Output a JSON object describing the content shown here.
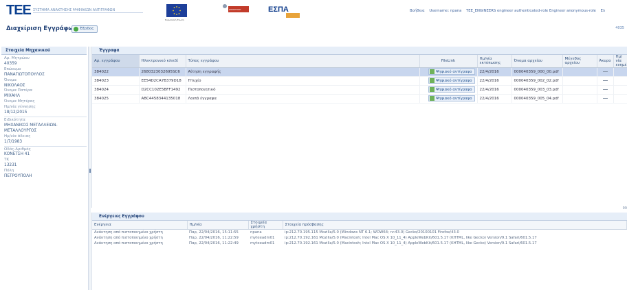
{
  "brand": {
    "logo": "ΤΕΕ",
    "subtitle": "ΣΥΣΤΗΜΑ ΑΝΑΚΤΗΣΗΣ ΨΗΦΙΑΚΩΝ ΑΝΤΙΓΡΑΦΩΝ",
    "eu_caption": "Ευρωπαϊκή Ένωση",
    "ministry": "ΔΙΟΙΚΗΤΙΚΗ ΜΕΤΑΡΡΥΘΜΙΣΗ",
    "espa": "ΕΣΠΑ",
    "espa_years": "2007-2013"
  },
  "header": {
    "help": "Βοήθεια",
    "username": "Username: npana",
    "roles": "TEE_ENGINEERS engineer authenticated-role Engineer anonymous-role",
    "lang": "Ελ",
    "right_extra": "4035"
  },
  "page": {
    "title": "Διαχείριση Εγγράφων",
    "exit_label": "Έξοδος"
  },
  "colors": {
    "accent": "#1d3e74",
    "header_bg": "#e6eef8",
    "selected_row": "#c8d6ee"
  },
  "sidebar": {
    "title": "Στοιχεία Μηχανικού",
    "fields": [
      {
        "label": "Αρ. Μητρώου",
        "value": "40359"
      },
      {
        "label": "Επώνυμο",
        "value": "ΠΑΝΑΓΙΩΤΟΠΟΥΛΟΣ"
      },
      {
        "label": "Όνομα",
        "value": "ΝΙΚΟΛΑΟΣ"
      },
      {
        "label": "Όνομα Πατέρα",
        "value": "ΜΙΧΑΗΛ"
      },
      {
        "label": "Όνομα Μητέρας",
        "value": ""
      },
      {
        "label": "Ημ/νία γέννησης",
        "value": "18/12/2015"
      }
    ],
    "fields2": [
      {
        "label": "Ειδικότητα",
        "value": "ΜΗΧΑΝΙΚΟΣ ΜΕΤΑΛΛΕΙΩΝ-ΜΕΤΑΛΛΟΥΡΓΟΣ"
      },
      {
        "label": "Ημ/νία άδειας",
        "value": "1/7/1983"
      }
    ],
    "fields3": [
      {
        "label": "Οδός-Αριθμός",
        "value": "ΚΟΝΕΤΣΗ 41"
      },
      {
        "label": "ΤΚ",
        "value": "13231"
      },
      {
        "label": "Πόλη",
        "value": "ΠΕΤΡΟΥΠΟΛΗ"
      }
    ]
  },
  "documents": {
    "title": "Έγγραφα",
    "columns": [
      "Αρ. εγγράφου",
      "Ηλεκτρονικό κλειδί",
      "Τύπος εγγράφου",
      "FileLink",
      "Ημ/νία εκτύπωσης",
      "Όνομα αρχείου",
      "Μέγεθος αρχείου",
      "Άκυρο",
      "Ημ/νία ενημέρωσης"
    ],
    "link_label": "Ψηφιακό αντίγραφο",
    "rows": [
      {
        "no": "384022",
        "key": "2680323032695SC6",
        "type": "Αίτηση εγγραφής",
        "date": "22/4/2016",
        "file": "000040359_000_00.pdf"
      },
      {
        "no": "384023",
        "key": "EE54D2CA7B379D18",
        "type": "Πτυχίο",
        "date": "22/4/2016",
        "file": "000040359_002_02.pdf"
      },
      {
        "no": "384024",
        "key": "D2CC102E5BFF1492",
        "type": "Πιστοποιητικό",
        "date": "22/4/2016",
        "file": "000040359_003_03.pdf"
      },
      {
        "no": "384025",
        "key": "ABC4458344135018",
        "type": "Λοιπά έγγραφα",
        "date": "22/4/2016",
        "file": "000040359_005_04.pdf"
      }
    ],
    "extra": "99"
  },
  "activity": {
    "title": "Ενέργειες Εγγράφου",
    "columns": [
      "Ενέργεια",
      "Ημ/νία",
      "Στοιχεία χρήστη",
      "Στοιχεία πρόσβασης"
    ],
    "rows": [
      {
        "action": "Ανάκτηση από πιστοποιημένο χρήστη",
        "date": "Παρ, 22/04/2016, 15:11:55",
        "user": "npana",
        "access": "ip:212.70.195.115 Mozilla/5.0 (Windows NT 6.1; WOW64; rv:43.0) Gecko/20100101 Firefox/43.0"
      },
      {
        "action": "Ανάκτηση από πιστοποιημένο χρήστη",
        "date": "Παρ, 22/04/2016, 11:22:59",
        "user": "myteeadm01",
        "access": "ip:212.70.192.161 Mozilla/5.0 (Macintosh; Intel Mac OS X 10_11_4) AppleWebKit/601.5.17 (KHTML, like Gecko) Version/9.1 Safari/601.5.17"
      },
      {
        "action": "Ανάκτηση από πιστοποιημένο χρήστη",
        "date": "Παρ, 22/04/2016, 11:22:49",
        "user": "myteeadm01",
        "access": "ip:212.70.192.161 Mozilla/5.0 (Macintosh; Intel Mac OS X 10_11_4) AppleWebKit/601.5.17 (KHTML, like Gecko) Version/9.1 Safari/601.5.17"
      }
    ]
  }
}
